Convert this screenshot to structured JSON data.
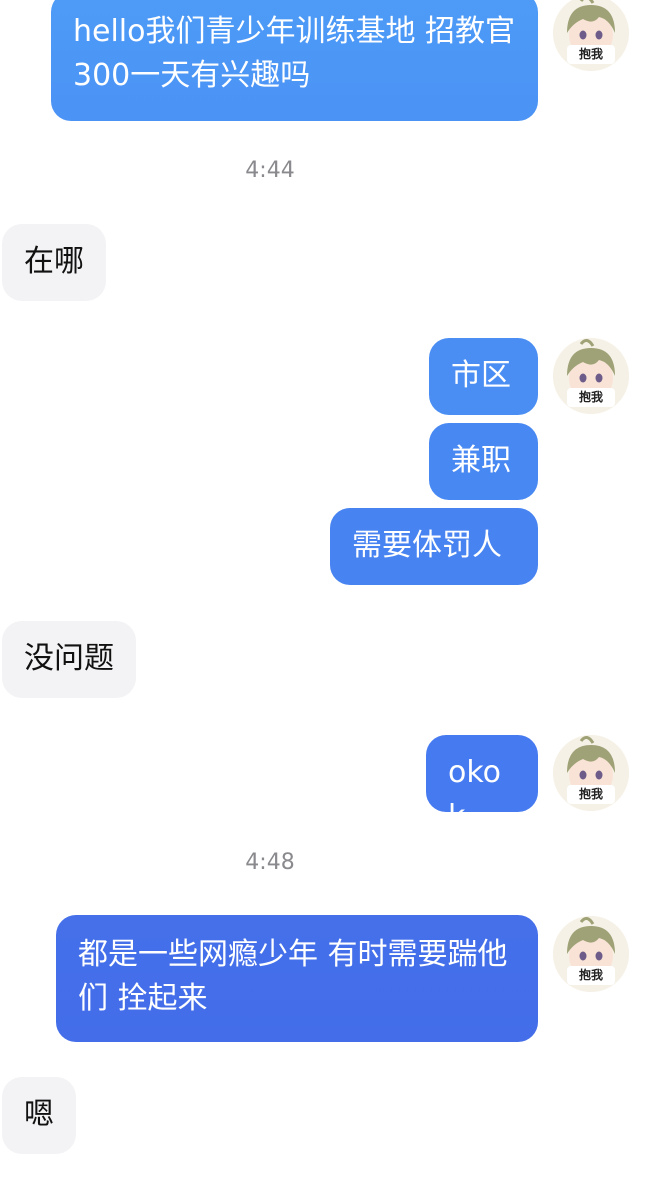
{
  "colors": {
    "sent_bubble_top": "#4b95f6",
    "sent_bubble_bottom": "#4570ea",
    "received_bubble": "#f3f3f5",
    "timestamp_text": "#8a8a8e"
  },
  "avatar": {
    "icon": "anime-boy-avatar",
    "badge": "抱我"
  },
  "messages": [
    {
      "side": "sent",
      "text": "hello我们青少年训练基地 招教官 300一天有兴趣吗"
    },
    {
      "type": "timestamp",
      "text": "4:44"
    },
    {
      "side": "received",
      "text": "在哪"
    },
    {
      "side": "sent",
      "text": "市区"
    },
    {
      "side": "sent",
      "text": "兼职"
    },
    {
      "side": "sent",
      "text": "需要体罚人"
    },
    {
      "side": "received",
      "text": "没问题"
    },
    {
      "side": "sent",
      "text": "okok"
    },
    {
      "type": "timestamp",
      "text": "4:48"
    },
    {
      "side": "sent",
      "text": "都是一些网瘾少年 有时需要踹他们 拴起来"
    },
    {
      "side": "received",
      "text": "嗯"
    }
  ]
}
